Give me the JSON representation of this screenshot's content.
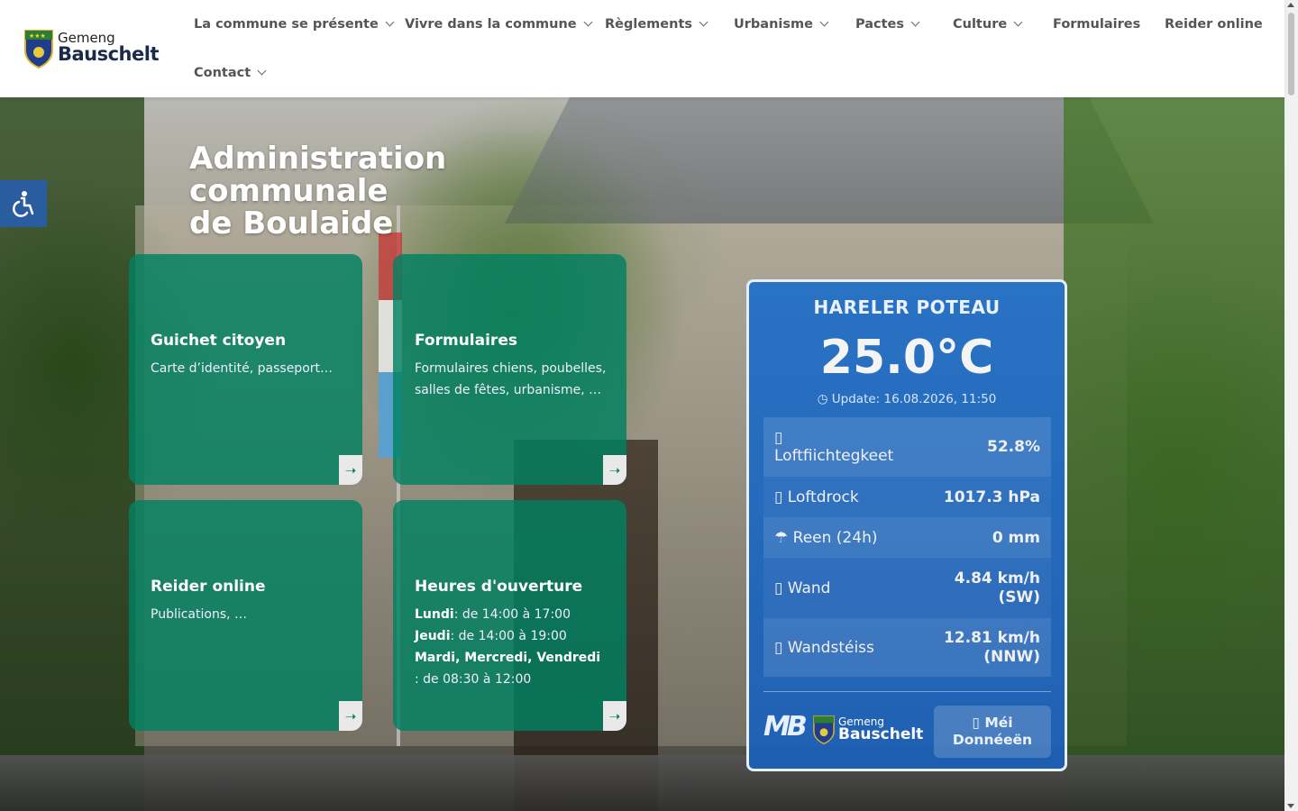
{
  "header": {
    "logo": {
      "line1": "Gemeng",
      "line2": "Bauschelt"
    },
    "nav": [
      {
        "label": "La commune se présente",
        "dropdown": true
      },
      {
        "label": "Vivre dans la commune",
        "dropdown": true
      },
      {
        "label": "Règlements",
        "dropdown": true
      },
      {
        "label": "Urbanisme",
        "dropdown": true
      },
      {
        "label": "Pactes",
        "dropdown": true
      },
      {
        "label": "Culture",
        "dropdown": true
      },
      {
        "label": "Formulaires",
        "dropdown": false
      },
      {
        "label": "Reider online",
        "dropdown": false
      },
      {
        "label": "Contact",
        "dropdown": true
      }
    ]
  },
  "hero": {
    "title_line1": "Administration communale",
    "title_line2": "de Boulaide"
  },
  "accessibility": {
    "icon": "accessibility-icon"
  },
  "cards": [
    {
      "title": "Guichet citoyen",
      "desc": "Carte d’identité, passeport…"
    },
    {
      "title": "Formulaires",
      "desc": "Formulaires chiens, poubelles, salles de fêtes, urbanisme, …"
    },
    {
      "title": "Reider online",
      "desc": "Publications, …"
    },
    {
      "title": "Heures d'ouverture",
      "hours": [
        {
          "day": "Lundi",
          "text": ": de 14:00 à 17:00"
        },
        {
          "day": "Jeudi",
          "text": ": de 14:00 à 19:00"
        },
        {
          "day": "Mardi, Mercredi, Vendredi",
          "text": " : de 08:30 à 12:00"
        }
      ]
    }
  ],
  "weather": {
    "location": "HARELER POTEAU",
    "temperature": "25.0°C",
    "update": "Update: 16.08.2026, 11:50",
    "rows": [
      {
        "icon": "humidity-icon",
        "label": "Loftfiichtegkeet",
        "value": "52.8%"
      },
      {
        "icon": "pressure-icon",
        "label": "Loftdrock",
        "value": "1017.3 hPa"
      },
      {
        "icon": "umbrella-icon",
        "label": "Reen (24h)",
        "value": "0 mm"
      },
      {
        "icon": "wind-icon",
        "label": "Wand",
        "value": "4.84 km/h (SW)"
      },
      {
        "icon": "gust-icon",
        "label": "Wandstéiss",
        "value": "12.81 km/h (NNW)"
      }
    ],
    "footer_logo": {
      "line1": "Gemeng",
      "line2": "Bauschelt"
    },
    "mb_logo": "MB",
    "button": "Méi Donnéeën"
  },
  "colors": {
    "card_bg": "#008060",
    "weather_bg": "#1e6ec8",
    "accessibility_bg": "#2a5d9f"
  }
}
